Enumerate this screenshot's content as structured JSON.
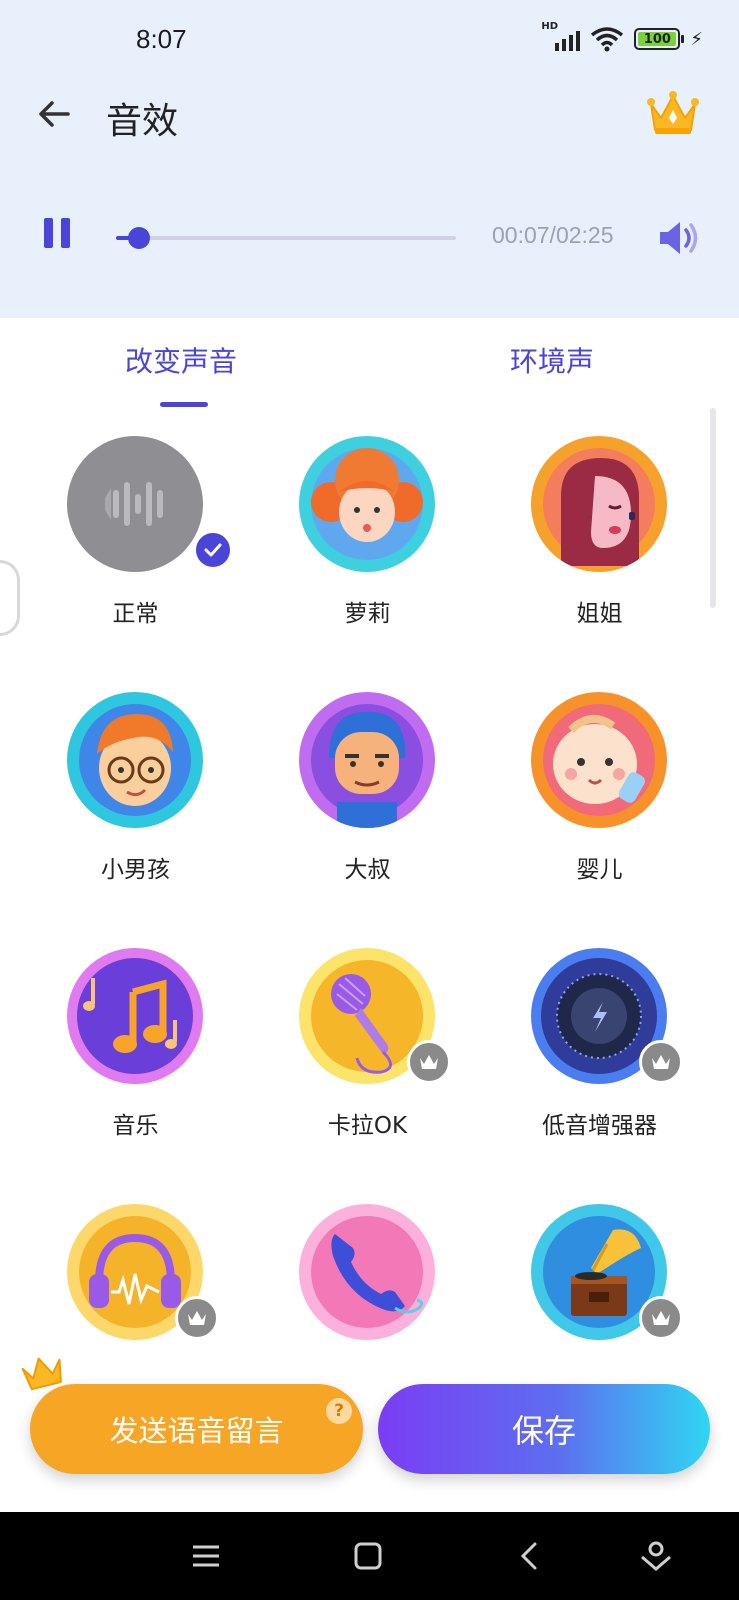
{
  "status_bar": {
    "time": "8:07",
    "network": "HD",
    "battery": "100"
  },
  "app_bar": {
    "title": "音效"
  },
  "player": {
    "time_label": "00:07/02:25",
    "progress": 0.067
  },
  "tabs": [
    {
      "label": "改变声音",
      "selected": true
    },
    {
      "label": "环境声",
      "selected": false
    }
  ],
  "effects": [
    {
      "label": "正常",
      "icon": "normal-wave-icon",
      "selected": true,
      "premium": false
    },
    {
      "label": "萝莉",
      "icon": "loli-girl-icon",
      "selected": false,
      "premium": false
    },
    {
      "label": "姐姐",
      "icon": "sister-woman-icon",
      "selected": false,
      "premium": false
    },
    {
      "label": "小男孩",
      "icon": "boy-glasses-icon",
      "selected": false,
      "premium": false
    },
    {
      "label": "大叔",
      "icon": "uncle-man-icon",
      "selected": false,
      "premium": false
    },
    {
      "label": "婴儿",
      "icon": "baby-icon",
      "selected": false,
      "premium": false
    },
    {
      "label": "音乐",
      "icon": "music-note-icon",
      "selected": false,
      "premium": false
    },
    {
      "label": "卡拉OK",
      "icon": "microphone-icon",
      "selected": false,
      "premium": true
    },
    {
      "label": "低音增强器",
      "icon": "bass-knob-icon",
      "selected": false,
      "premium": true
    },
    {
      "label": "",
      "icon": "headphones-icon",
      "selected": false,
      "premium": true
    },
    {
      "label": "",
      "icon": "telephone-icon",
      "selected": false,
      "premium": false
    },
    {
      "label": "",
      "icon": "gramophone-icon",
      "selected": false,
      "premium": true
    }
  ],
  "actions": {
    "voicemail_label": "发送语音留言",
    "help": "?",
    "save_label": "保存"
  },
  "colors": {
    "accent": "#4a44d8",
    "header_bg": "#e8f0fb",
    "voicemail": "#f6a524",
    "premium_badge": "#8a8a8a"
  }
}
